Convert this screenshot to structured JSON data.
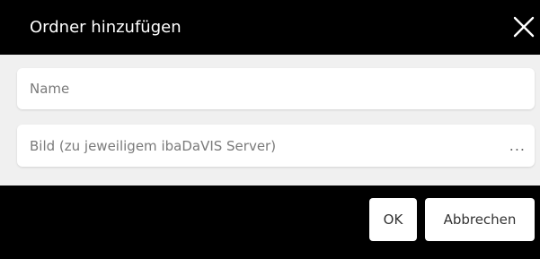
{
  "dialog": {
    "title": "Ordner hinzufügen",
    "close_icon": "close-icon"
  },
  "form": {
    "name_placeholder": "Name",
    "image_placeholder": "Bild (zu jeweiligem ibaDaVIS Server)",
    "browse_label": "..."
  },
  "footer": {
    "ok_label": "OK",
    "cancel_label": "Abbrechen"
  },
  "colors": {
    "header_bg": "#000000",
    "body_bg": "#f0f0f0",
    "field_bg": "#ffffff",
    "button_bg": "#ffffff"
  }
}
